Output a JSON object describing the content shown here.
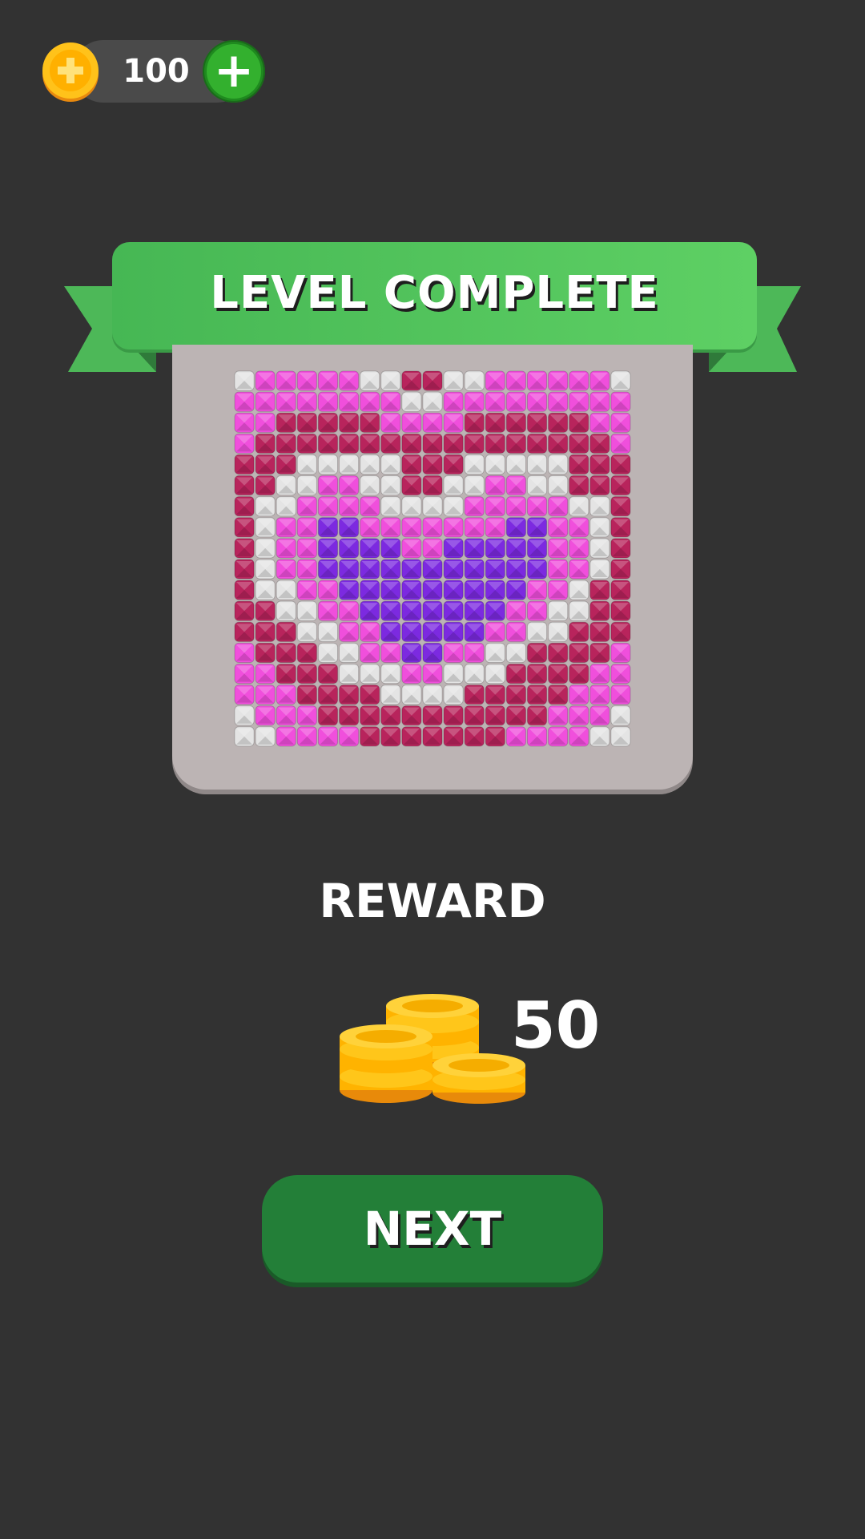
{
  "header": {
    "coin_icon": "gold-coin-icon",
    "coin_count": "100",
    "add_icon": "plus-icon"
  },
  "banner": {
    "title": "LEVEL COMPLETE"
  },
  "puzzle": {
    "palette": {
      "W": "#e4e4e4",
      "P": "#f04fdc",
      "R": "#b8245c",
      "V": "#7c2ae0"
    },
    "rows": [
      "WPPPPPWWRRWWPPPPPPW",
      "PPPPPPPPWWPPPPPPPPP",
      "PPRRRRRPPPPRRRRRRPP",
      "PRRRRRRRRRRRRRRRRRP",
      "RRRWWWWWRRRWWWWWRRR",
      "RRWWPPWWRRWWPPWWRRR",
      "RWWPPPPWWWWPPPPPWWR",
      "RWPPVVPPPPPPPVVPPWR",
      "RWPPVVVVPPVVVVVPPWR",
      "RWPPVVVVVVVVVVVPPWR",
      "RWWPPVVVVVVVVVPPWRR",
      "RRWWPPVVVVVVVPPWWRR",
      "RRRWWPPVVVVVPPWWRRR",
      "PRRRWWPPVVPPWWRRRRP",
      "PPRRRWWWPPWWWRRRRPP",
      "PPPRRRRWWWWRRRRRPPP",
      "WPPPRRRRRRRRRRRPPPW",
      "WWPPPPRRRRRRRPPPPWW"
    ]
  },
  "reward": {
    "label": "REWARD",
    "icon": "coin-stack-icon",
    "amount": "50"
  },
  "next_button": {
    "label": "NEXT"
  },
  "colors": {
    "background": "#323232",
    "banner_green": "#4fc25a",
    "button_green": "#237f38",
    "card_gray": "#bcb4b4"
  }
}
